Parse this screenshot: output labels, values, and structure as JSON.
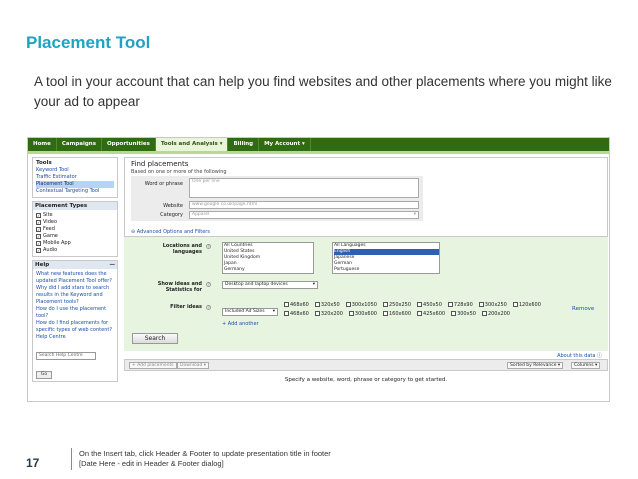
{
  "slide": {
    "title": "Placement Tool",
    "description": "A tool in your account that can help you find websites and other placements where you might like your ad to appear"
  },
  "nav": {
    "items": [
      "Home",
      "Campaigns",
      "Opportunities",
      "Tools and Analysis ▾",
      "Billing",
      "My Account ▾"
    ],
    "active_index": 3
  },
  "sidebar": {
    "tools_title": "Tools",
    "tools_links": [
      "Keyword Tool",
      "Traffic Estimator",
      "Placement Tool",
      "Contextual Targeting Tool"
    ],
    "selected_tool": "Placement Tool",
    "placement_types_title": "Placement Types",
    "placement_types": [
      "Site",
      "Video",
      "Feed",
      "Game",
      "Mobile App",
      "Audio"
    ],
    "help_title": "Help",
    "help_links": [
      "What new features does the updated Placement Tool offer?",
      "Why did I add stars to search results in the Keyword and Placement tools?",
      "How do I use the placement tool?",
      "How do I find placements for specific types of web content?",
      "Help Centre"
    ],
    "help_search_placeholder": "Search Help Centre",
    "help_search_button": "Go"
  },
  "find": {
    "title": "Find placements",
    "subtitle": "Based on one or more of the following",
    "word_label": "Word or phrase",
    "word_placeholder": "One per line",
    "website_label": "Website",
    "website_placeholder": "www.google.co.uk/page.html",
    "category_label": "Category",
    "category_value": "Apparel",
    "advanced_link": "⊖ Advanced Options and Filters"
  },
  "advanced": {
    "locations_label": "Locations and languages",
    "countries": [
      "All Countries",
      "United States",
      "United Kingdom",
      "Japan",
      "Germany"
    ],
    "languages": [
      "All Languages",
      "English",
      "Japanese",
      "German",
      "Portuguese"
    ],
    "selected_language": "English",
    "show_ideas_label": "Show ideas and Statistics for",
    "devices_value": "Desktop and laptop devices",
    "filter_label": "Filter ideas",
    "filter_value": "Included Ad Sizes",
    "sizes_row1": [
      "468x60",
      "320x50",
      "300x1050",
      "250x250",
      "450x50",
      "728x90",
      "300x250",
      "120x600"
    ],
    "sizes_row2": [
      "468x60",
      "320x200",
      "300x600",
      "160x600",
      "425x600",
      "300x50",
      "200x200"
    ],
    "remove": "Remove",
    "add_another": "+ Add another"
  },
  "search_button": "Search",
  "about_link": "About this data ⓘ",
  "results_bar": {
    "add_placements": "+ Add placements",
    "download": "Download ▾",
    "sort": "Sorted by Relevance ▾",
    "columns": "Columns ▾"
  },
  "empty_message": "Specify a website, word, phrase or category to get started.",
  "footer": {
    "page_number": "17",
    "line1": "On the Insert tab, click Header & Footer to update presentation title in footer",
    "line2": "[Date Here - edit in Header & Footer dialog]"
  },
  "colors": {
    "title": "#1fa3c3",
    "nav_bg": "#2e6b12",
    "panel_bg": "#e7f4e0",
    "link": "#1a4fa8"
  }
}
